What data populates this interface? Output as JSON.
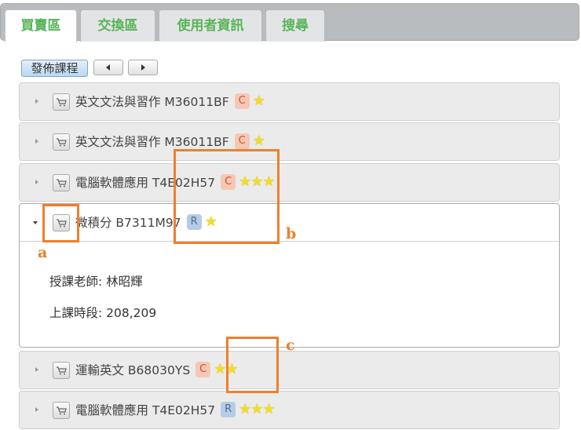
{
  "tabs": [
    {
      "label": "買賣區",
      "active": true
    },
    {
      "label": "交換區",
      "active": false
    },
    {
      "label": "使用者資訊",
      "active": false
    },
    {
      "label": "搜尋",
      "active": false
    }
  ],
  "toolbar": {
    "publish_label": "發佈課程",
    "prev_icon": "triangle-left-icon",
    "next_icon": "triangle-right-icon"
  },
  "courses": [
    {
      "title": "英文文法與習作 M36011BF",
      "badge": "C",
      "stars": "★",
      "star_count": 1,
      "expanded": false
    },
    {
      "title": "英文文法與習作 M36011BF",
      "badge": "C",
      "stars": "★",
      "star_count": 1,
      "expanded": false
    },
    {
      "title": "電腦軟體應用 T4E02H57",
      "badge": "C",
      "stars": "★★★",
      "star_count": 3,
      "expanded": false
    },
    {
      "title": "微積分 B7311M97",
      "badge": "R",
      "stars": "★",
      "star_count": 1,
      "expanded": true,
      "teacher": "授課老師: 林昭輝",
      "time": "上課時段: 208,209"
    },
    {
      "title": "運輸英文 B68030YS",
      "badge": "C",
      "stars": "★★",
      "star_count": 2,
      "expanded": false
    },
    {
      "title": "電腦軟體應用 T4E02H57",
      "badge": "R",
      "stars": "★★★",
      "star_count": 3,
      "expanded": false
    }
  ],
  "annotations": {
    "a": "a",
    "b": "b",
    "c": "c"
  },
  "colors": {
    "accent_tab_text": "#58b558",
    "badge_c": "#f6c7b4",
    "badge_r": "#b6cbe6",
    "star": "#f3dc26",
    "annotation": "#ef7f2c"
  }
}
